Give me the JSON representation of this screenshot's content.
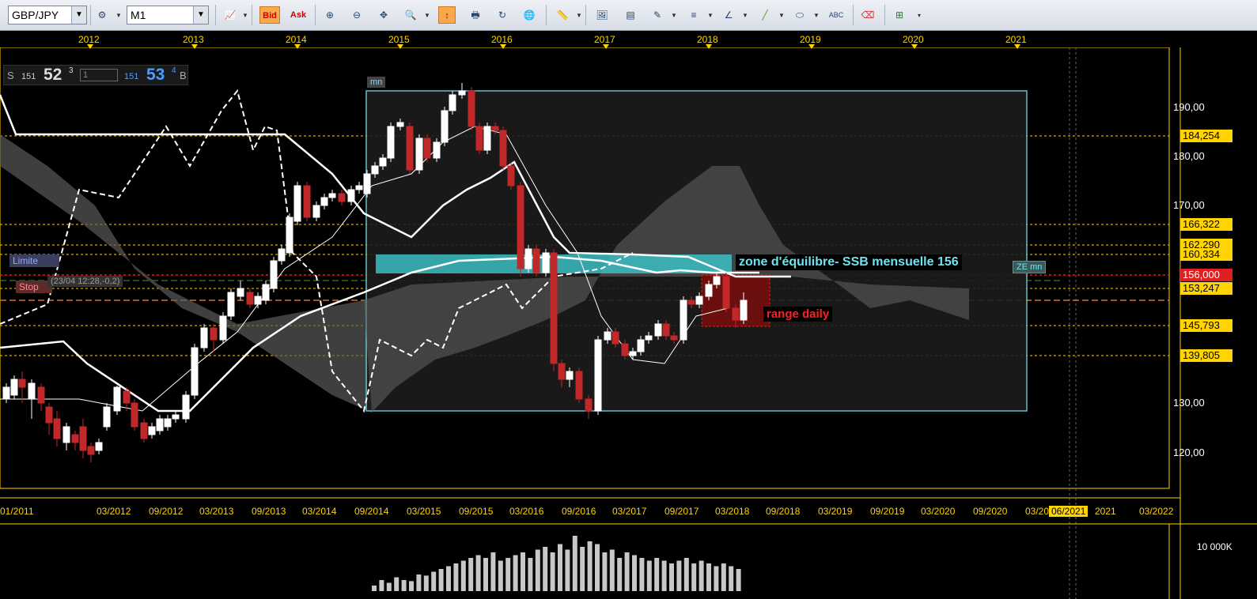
{
  "toolbar": {
    "symbol": "GBP/JPY",
    "timeframe": "M1",
    "bid_label": "Bid",
    "ask_label": "Ask"
  },
  "chart": {
    "top_years": [
      "2012",
      "2013",
      "2014",
      "2015",
      "2016",
      "2017",
      "2018",
      "2019",
      "2020",
      "2021"
    ],
    "bottom_dates": [
      "01/2011",
      "03/2012",
      "09/2012",
      "03/2013",
      "09/2013",
      "03/2014",
      "09/2014",
      "03/2015",
      "09/2015",
      "03/2016",
      "09/2016",
      "03/2017",
      "09/2017",
      "03/2018",
      "09/2018",
      "03/2019",
      "09/2019",
      "03/2020",
      "09/2020",
      "03/20",
      "06/2021",
      "2021",
      "03/2022"
    ],
    "price_ticks": [
      "190,00",
      "180,00",
      "170,00",
      "130,00",
      "120,00"
    ],
    "price_levels": [
      {
        "label": "184,254",
        "color": "#ffd400"
      },
      {
        "label": "166,322",
        "color": "#ffd400"
      },
      {
        "label": "162,290",
        "color": "#ffd400"
      },
      {
        "label": "160,334",
        "color": "#ffd400"
      },
      {
        "label": "156,000",
        "color": "#e02020"
      },
      {
        "label": "153,247",
        "color": "#ffd400"
      },
      {
        "label": "145,793",
        "color": "#ffd400"
      },
      {
        "label": "139,805",
        "color": "#ffd400"
      }
    ],
    "volume_tick": "10 000K",
    "annotations": {
      "zone_label": "zone d'équilibre- SSB mensuelle 156",
      "ze_tag": "ZE mn",
      "mn_tag": "mn",
      "range_label": "range daily",
      "limite_tag": "Limite",
      "stop_tag": "Stop",
      "order_info": "(23/04 12:28,-0,2)"
    },
    "quote": {
      "sell_label": "S",
      "sell_big": "151",
      "sell_pips": "52",
      "sell_frac": "3",
      "lots": "1",
      "buy_big": "151",
      "buy_pips": "53",
      "buy_frac": "4",
      "buy_label": "B"
    },
    "colors": {
      "bull": "#ffffff",
      "bear": "#c0282a",
      "grid": "#ffd400",
      "cloud": "#5a5a5a",
      "box": "#6fd3e0",
      "zone": "#3bbec4"
    }
  }
}
